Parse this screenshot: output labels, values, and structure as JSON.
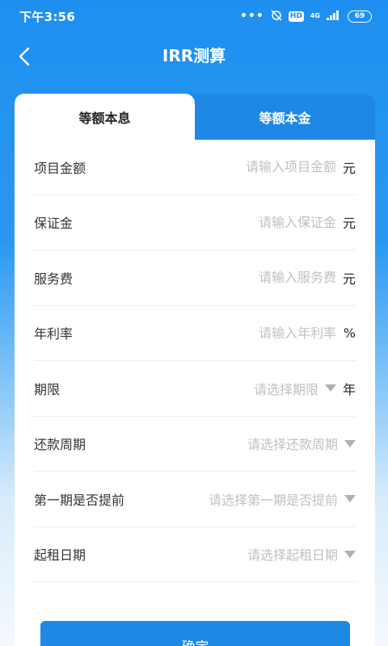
{
  "status": {
    "time": "下午3:56",
    "dots": "•••",
    "hd": "HD",
    "network": "4G",
    "battery": "69"
  },
  "nav": {
    "title": "IRR测算",
    "back_icon": "chevron-left-icon"
  },
  "tabs": [
    {
      "label": "等额本息",
      "active": true
    },
    {
      "label": "等额本金",
      "active": false
    }
  ],
  "form": {
    "rows": [
      {
        "label": "项目金额",
        "placeholder": "请输入项目金额",
        "unit": "元",
        "type": "input"
      },
      {
        "label": "保证金",
        "placeholder": "请输入保证金",
        "unit": "元",
        "type": "input"
      },
      {
        "label": "服务费",
        "placeholder": "请输入服务费",
        "unit": "元",
        "type": "input"
      },
      {
        "label": "年利率",
        "placeholder": "请输入年利率",
        "unit": "%",
        "type": "input"
      },
      {
        "label": "期限",
        "placeholder": "请选择期限",
        "unit": "年",
        "type": "select"
      },
      {
        "label": "还款周期",
        "placeholder": "请选择还款周期",
        "unit": "",
        "type": "select"
      },
      {
        "label": "第一期是否提前",
        "placeholder": "请选择第一期是否提前",
        "unit": "",
        "type": "select"
      },
      {
        "label": "起租日期",
        "placeholder": "请选择起租日期",
        "unit": "",
        "type": "select"
      }
    ]
  },
  "confirm_label": "确定",
  "colors": {
    "primary": "#1e88e5",
    "header": "#1e8ff0",
    "placeholder": "#c0c0c0"
  }
}
